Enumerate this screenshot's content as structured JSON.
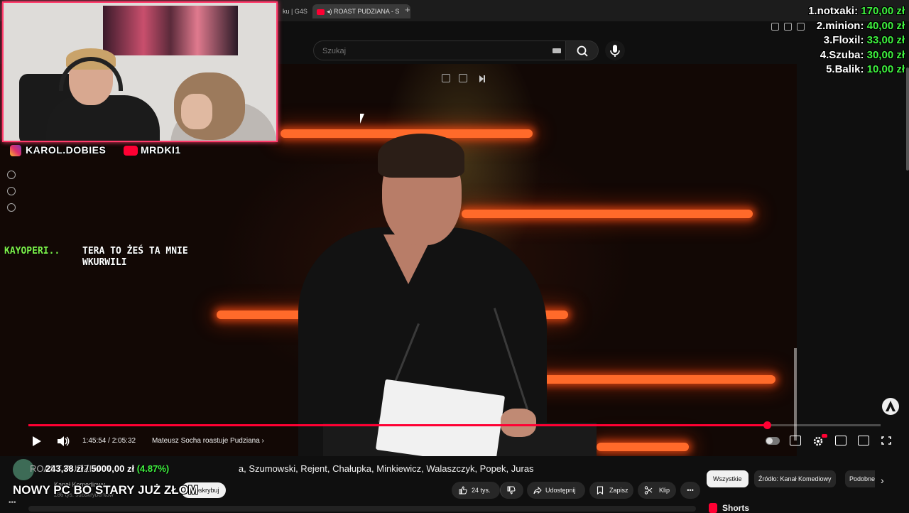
{
  "browser": {
    "tabs": [
      {
        "label": "ku | G4S"
      },
      {
        "label": "ROAST PUDZIANA - S"
      }
    ],
    "new_tab": "+"
  },
  "header": {
    "search_placeholder": "Szukaj"
  },
  "player": {
    "time": "1:45:54 / 2:05:32",
    "chapter": "Mateusz Socha roastuje Pudziana",
    "chapter_arrow": "›",
    "progress": 0.867
  },
  "video_info": {
    "title_prefix": "ROAST PUDZIANA",
    "title_visible": "a, Szumowski, Rejent, Chałupka, Minkiewicz, Walaszczyk, Popek, Juras",
    "channel": "Kanał Komediowy",
    "subscribers": "286 tys. subskrybentów",
    "subscribe": "Subskrybuj"
  },
  "actions": {
    "likes": "24 tys.",
    "share": "Udostępnij",
    "save": "Zapisz",
    "clip": "Klip",
    "more": "•••"
  },
  "filters": {
    "all": "Wszystkie",
    "source": "Źródło: Kanał Komediowy",
    "similar": "Podobne",
    "next": "›"
  },
  "shorts": {
    "label": "Shorts"
  },
  "overlay": {
    "socials": {
      "instagram": "KAROL.DOBIES",
      "youtube": "MRDKI1"
    },
    "chat": {
      "user": "KAYOPERI..",
      "message": "TERA TO ŻEŚ TA MNIE WKURWILI"
    },
    "leaderboard": [
      {
        "rank_name": "1.notxaki:",
        "amount": "170,00 zł"
      },
      {
        "rank_name": "2.minion:",
        "amount": "40,00 zł"
      },
      {
        "rank_name": "3.Floxil:",
        "amount": "33,00 zł"
      },
      {
        "rank_name": "4.Szuba:",
        "amount": "30,00 zł"
      },
      {
        "rank_name": "5.Balik:",
        "amount": "10,00 zł"
      }
    ],
    "donation_goal": {
      "current": "243,38 zł",
      "separator": " / ",
      "target": "5000,00 zł",
      "percent": "(4.87%)",
      "label": "NOWY PC BO STARY JUŻ ZŁOM"
    }
  },
  "colors": {
    "accent": "#ff0033",
    "webcam_border": "#ff3b6b",
    "leaderboard_amount": "#3ff23f",
    "chat_user": "#7cf24a"
  }
}
